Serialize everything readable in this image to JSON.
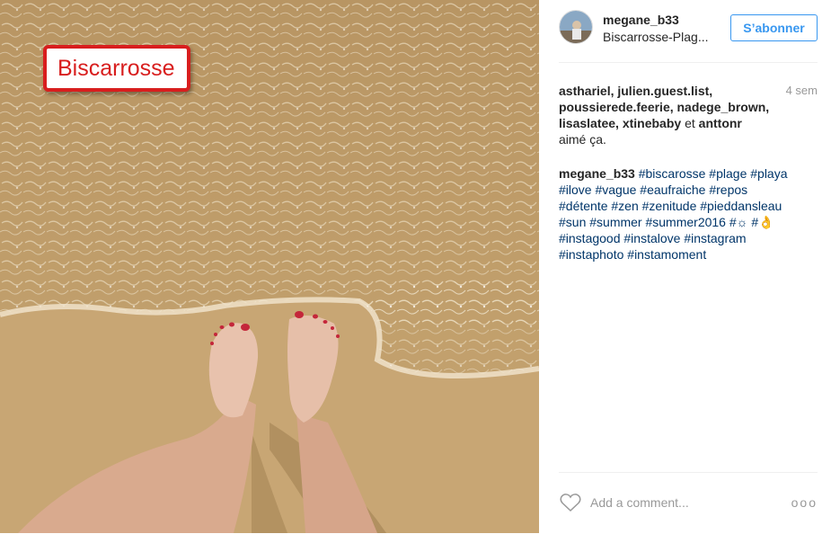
{
  "photo": {
    "annotation_label": "Biscarrosse"
  },
  "header": {
    "username": "megane_b33",
    "location": "Biscarrosse-Plag...",
    "follow_label": "S’abonner"
  },
  "likes": {
    "users_line1": "asthariel, julien.guest.list,",
    "users_line2": "poussierede.feerie, nadege_brown,",
    "users_line3_a": "lisaslatee, xtinebaby",
    "users_line3_and": " et ",
    "users_line3_b": "anttonr",
    "suffix": "aimé ça.",
    "time": "4 sem"
  },
  "caption": {
    "user": "megane_b33",
    "line1": "#biscarosse #plage #playa",
    "line2": "#ilove #vague #eaufraiche #repos",
    "line3": "#détente #zen #zenitude #pieddansleau",
    "line4": "#sun #summer #summer2016 #☼ #👌",
    "line5": "#instagood #instalove #instagram",
    "line6": "#instaphoto #instamoment"
  },
  "footer": {
    "comment_placeholder": "Add a comment...",
    "more_label": "ooo"
  }
}
